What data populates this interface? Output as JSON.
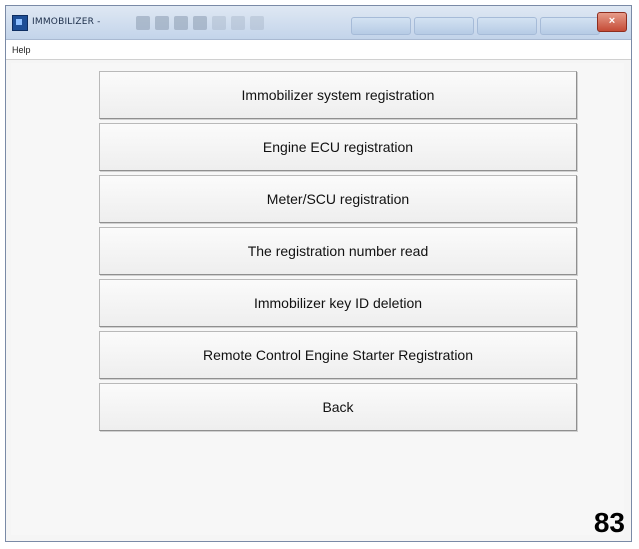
{
  "window": {
    "title": "IMMOBILIZER -",
    "close_label": "×"
  },
  "menu": {
    "help_label": "Help"
  },
  "buttons": [
    "Immobilizer system registration",
    "Engine ECU registration",
    "Meter/SCU registration",
    "The registration number read",
    "Immobilizer key ID deletion",
    "Remote Control Engine Starter Registration",
    "Back"
  ],
  "page_number": "83",
  "colors": {
    "titlebar": "#c3d4ea",
    "close_button": "#c44b36",
    "button_face": "#eeeeee"
  }
}
